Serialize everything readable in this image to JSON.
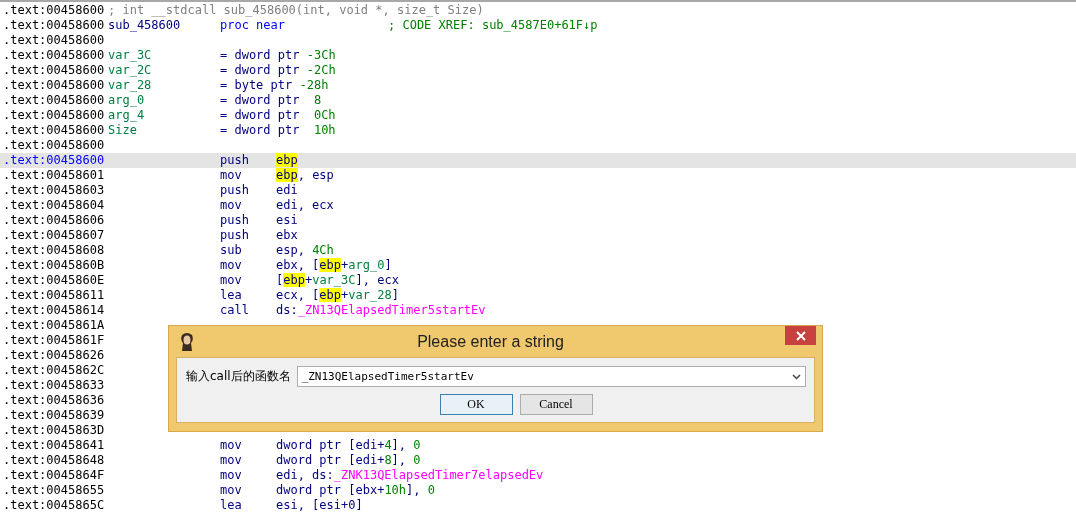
{
  "listing": [
    {
      "addr": ".text:00458600",
      "selected": false,
      "prototype": "; int __stdcall sub_458600(int, void *, size_t Size)"
    },
    {
      "addr": ".text:00458600",
      "selected": false,
      "label": {
        "text": "sub_458600",
        "kind": "func"
      },
      "operands": [
        {
          "text": "proc near",
          "kind": "directive",
          "highlighted": false
        }
      ],
      "comment": "; CODE XREF: sub_4587E0+61F↓p"
    },
    {
      "addr": ".text:00458600",
      "selected": false
    },
    {
      "addr": ".text:00458600",
      "selected": false,
      "label": {
        "text": "var_3C",
        "kind": "var"
      },
      "operands": [
        {
          "text": "= dword ptr ",
          "kind": "reg",
          "highlighted": false
        },
        {
          "text": "-3Ch",
          "kind": "num",
          "highlighted": false
        }
      ]
    },
    {
      "addr": ".text:00458600",
      "selected": false,
      "label": {
        "text": "var_2C",
        "kind": "var"
      },
      "operands": [
        {
          "text": "= dword ptr ",
          "kind": "reg",
          "highlighted": false
        },
        {
          "text": "-2Ch",
          "kind": "num",
          "highlighted": false
        }
      ]
    },
    {
      "addr": ".text:00458600",
      "selected": false,
      "label": {
        "text": "var_28",
        "kind": "var"
      },
      "operands": [
        {
          "text": "= byte ptr ",
          "kind": "reg",
          "highlighted": false
        },
        {
          "text": "-28h",
          "kind": "num",
          "highlighted": false
        }
      ]
    },
    {
      "addr": ".text:00458600",
      "selected": false,
      "label": {
        "text": "arg_0",
        "kind": "var"
      },
      "operands": [
        {
          "text": "= dword ptr  ",
          "kind": "reg",
          "highlighted": false
        },
        {
          "text": "8",
          "kind": "num",
          "highlighted": false
        }
      ]
    },
    {
      "addr": ".text:00458600",
      "selected": false,
      "label": {
        "text": "arg_4",
        "kind": "var"
      },
      "operands": [
        {
          "text": "= dword ptr  ",
          "kind": "reg",
          "highlighted": false
        },
        {
          "text": "0Ch",
          "kind": "num",
          "highlighted": false
        }
      ]
    },
    {
      "addr": ".text:00458600",
      "selected": false,
      "label": {
        "text": "Size",
        "kind": "var"
      },
      "operands": [
        {
          "text": "= dword ptr  ",
          "kind": "reg",
          "highlighted": false
        },
        {
          "text": "10h",
          "kind": "num",
          "highlighted": false
        }
      ]
    },
    {
      "addr": ".text:00458600",
      "selected": false
    },
    {
      "addr": ".text:00458600",
      "selected": true,
      "mnemonic": "push",
      "operands": [
        {
          "text": "ebp",
          "kind": "reg",
          "highlighted": true
        }
      ]
    },
    {
      "addr": ".text:00458601",
      "selected": false,
      "mnemonic": "mov",
      "operands": [
        {
          "text": "ebp",
          "kind": "reg",
          "highlighted": true
        },
        {
          "text": ", esp",
          "kind": "reg",
          "highlighted": false
        }
      ]
    },
    {
      "addr": ".text:00458603",
      "selected": false,
      "mnemonic": "push",
      "operands": [
        {
          "text": "edi",
          "kind": "reg",
          "highlighted": false
        }
      ]
    },
    {
      "addr": ".text:00458604",
      "selected": false,
      "mnemonic": "mov",
      "operands": [
        {
          "text": "edi, ecx",
          "kind": "reg",
          "highlighted": false
        }
      ]
    },
    {
      "addr": ".text:00458606",
      "selected": false,
      "mnemonic": "push",
      "operands": [
        {
          "text": "esi",
          "kind": "reg",
          "highlighted": false
        }
      ]
    },
    {
      "addr": ".text:00458607",
      "selected": false,
      "mnemonic": "push",
      "operands": [
        {
          "text": "ebx",
          "kind": "reg",
          "highlighted": false
        }
      ]
    },
    {
      "addr": ".text:00458608",
      "selected": false,
      "mnemonic": "sub",
      "operands": [
        {
          "text": "esp, ",
          "kind": "reg",
          "highlighted": false
        },
        {
          "text": "4Ch",
          "kind": "num",
          "highlighted": false
        }
      ]
    },
    {
      "addr": ".text:0045860B",
      "selected": false,
      "mnemonic": "mov",
      "operands": [
        {
          "text": "ebx, [",
          "kind": "reg",
          "highlighted": false
        },
        {
          "text": "ebp",
          "kind": "reg",
          "highlighted": true
        },
        {
          "text": "+",
          "kind": "reg",
          "highlighted": false
        },
        {
          "text": "arg_0",
          "kind": "var",
          "highlighted": false
        },
        {
          "text": "]",
          "kind": "reg",
          "highlighted": false
        }
      ]
    },
    {
      "addr": ".text:0045860E",
      "selected": false,
      "mnemonic": "mov",
      "operands": [
        {
          "text": "[",
          "kind": "reg",
          "highlighted": false
        },
        {
          "text": "ebp",
          "kind": "reg",
          "highlighted": true
        },
        {
          "text": "+",
          "kind": "reg",
          "highlighted": false
        },
        {
          "text": "var_3C",
          "kind": "var",
          "highlighted": false
        },
        {
          "text": "], ecx",
          "kind": "reg",
          "highlighted": false
        }
      ]
    },
    {
      "addr": ".text:00458611",
      "selected": false,
      "mnemonic": "lea",
      "operands": [
        {
          "text": "ecx, [",
          "kind": "reg",
          "highlighted": false
        },
        {
          "text": "ebp",
          "kind": "reg",
          "highlighted": true
        },
        {
          "text": "+",
          "kind": "reg",
          "highlighted": false
        },
        {
          "text": "var_28",
          "kind": "var",
          "highlighted": false
        },
        {
          "text": "]",
          "kind": "reg",
          "highlighted": false
        }
      ]
    },
    {
      "addr": ".text:00458614",
      "selected": false,
      "mnemonic": "call",
      "operands": [
        {
          "text": "ds:",
          "kind": "reg",
          "highlighted": false
        },
        {
          "text": "_ZN13QElapsedTimer5startEv",
          "kind": "sym",
          "highlighted": false
        }
      ]
    },
    {
      "addr": ".text:0045861A",
      "selected": false
    },
    {
      "addr": ".text:0045861F",
      "selected": false
    },
    {
      "addr": ".text:00458626",
      "selected": false
    },
    {
      "addr": ".text:0045862C",
      "selected": false
    },
    {
      "addr": ".text:00458633",
      "selected": false
    },
    {
      "addr": ".text:00458636",
      "selected": false
    },
    {
      "addr": ".text:00458639",
      "selected": false
    },
    {
      "addr": ".text:0045863D",
      "selected": false
    },
    {
      "addr": ".text:00458641",
      "selected": false,
      "mnemonic": "mov",
      "operands": [
        {
          "text": "dword ptr [edi+",
          "kind": "reg",
          "highlighted": false
        },
        {
          "text": "4",
          "kind": "num",
          "highlighted": false
        },
        {
          "text": "], ",
          "kind": "reg",
          "highlighted": false
        },
        {
          "text": "0",
          "kind": "num",
          "highlighted": false
        }
      ]
    },
    {
      "addr": ".text:00458648",
      "selected": false,
      "mnemonic": "mov",
      "operands": [
        {
          "text": "dword ptr [edi+",
          "kind": "reg",
          "highlighted": false
        },
        {
          "text": "8",
          "kind": "num",
          "highlighted": false
        },
        {
          "text": "], ",
          "kind": "reg",
          "highlighted": false
        },
        {
          "text": "0",
          "kind": "num",
          "highlighted": false
        }
      ]
    },
    {
      "addr": ".text:0045864F",
      "selected": false,
      "mnemonic": "mov",
      "operands": [
        {
          "text": "edi, ds:",
          "kind": "reg",
          "highlighted": false
        },
        {
          "text": "_ZNK13QElapsedTimer7elapsedEv",
          "kind": "sym",
          "highlighted": false
        }
      ]
    },
    {
      "addr": ".text:00458655",
      "selected": false,
      "mnemonic": "mov",
      "operands": [
        {
          "text": "dword ptr [ebx+",
          "kind": "reg",
          "highlighted": false
        },
        {
          "text": "10h",
          "kind": "num",
          "highlighted": false
        },
        {
          "text": "], ",
          "kind": "reg",
          "highlighted": false
        },
        {
          "text": "0",
          "kind": "num",
          "highlighted": false
        }
      ]
    },
    {
      "addr": ".text:0045865C",
      "selected": false,
      "mnemonic": "lea",
      "operands": [
        {
          "text": "esi, [esi+0]",
          "kind": "reg",
          "highlighted": false
        }
      ]
    }
  ],
  "dialog": {
    "title": "Please enter a string",
    "label": "输入call后的函数名",
    "value": "_ZN13QElapsedTimer5startEv",
    "buttons": [
      {
        "label": "OK",
        "focused": true
      },
      {
        "label": "Cancel",
        "focused": false
      }
    ]
  }
}
